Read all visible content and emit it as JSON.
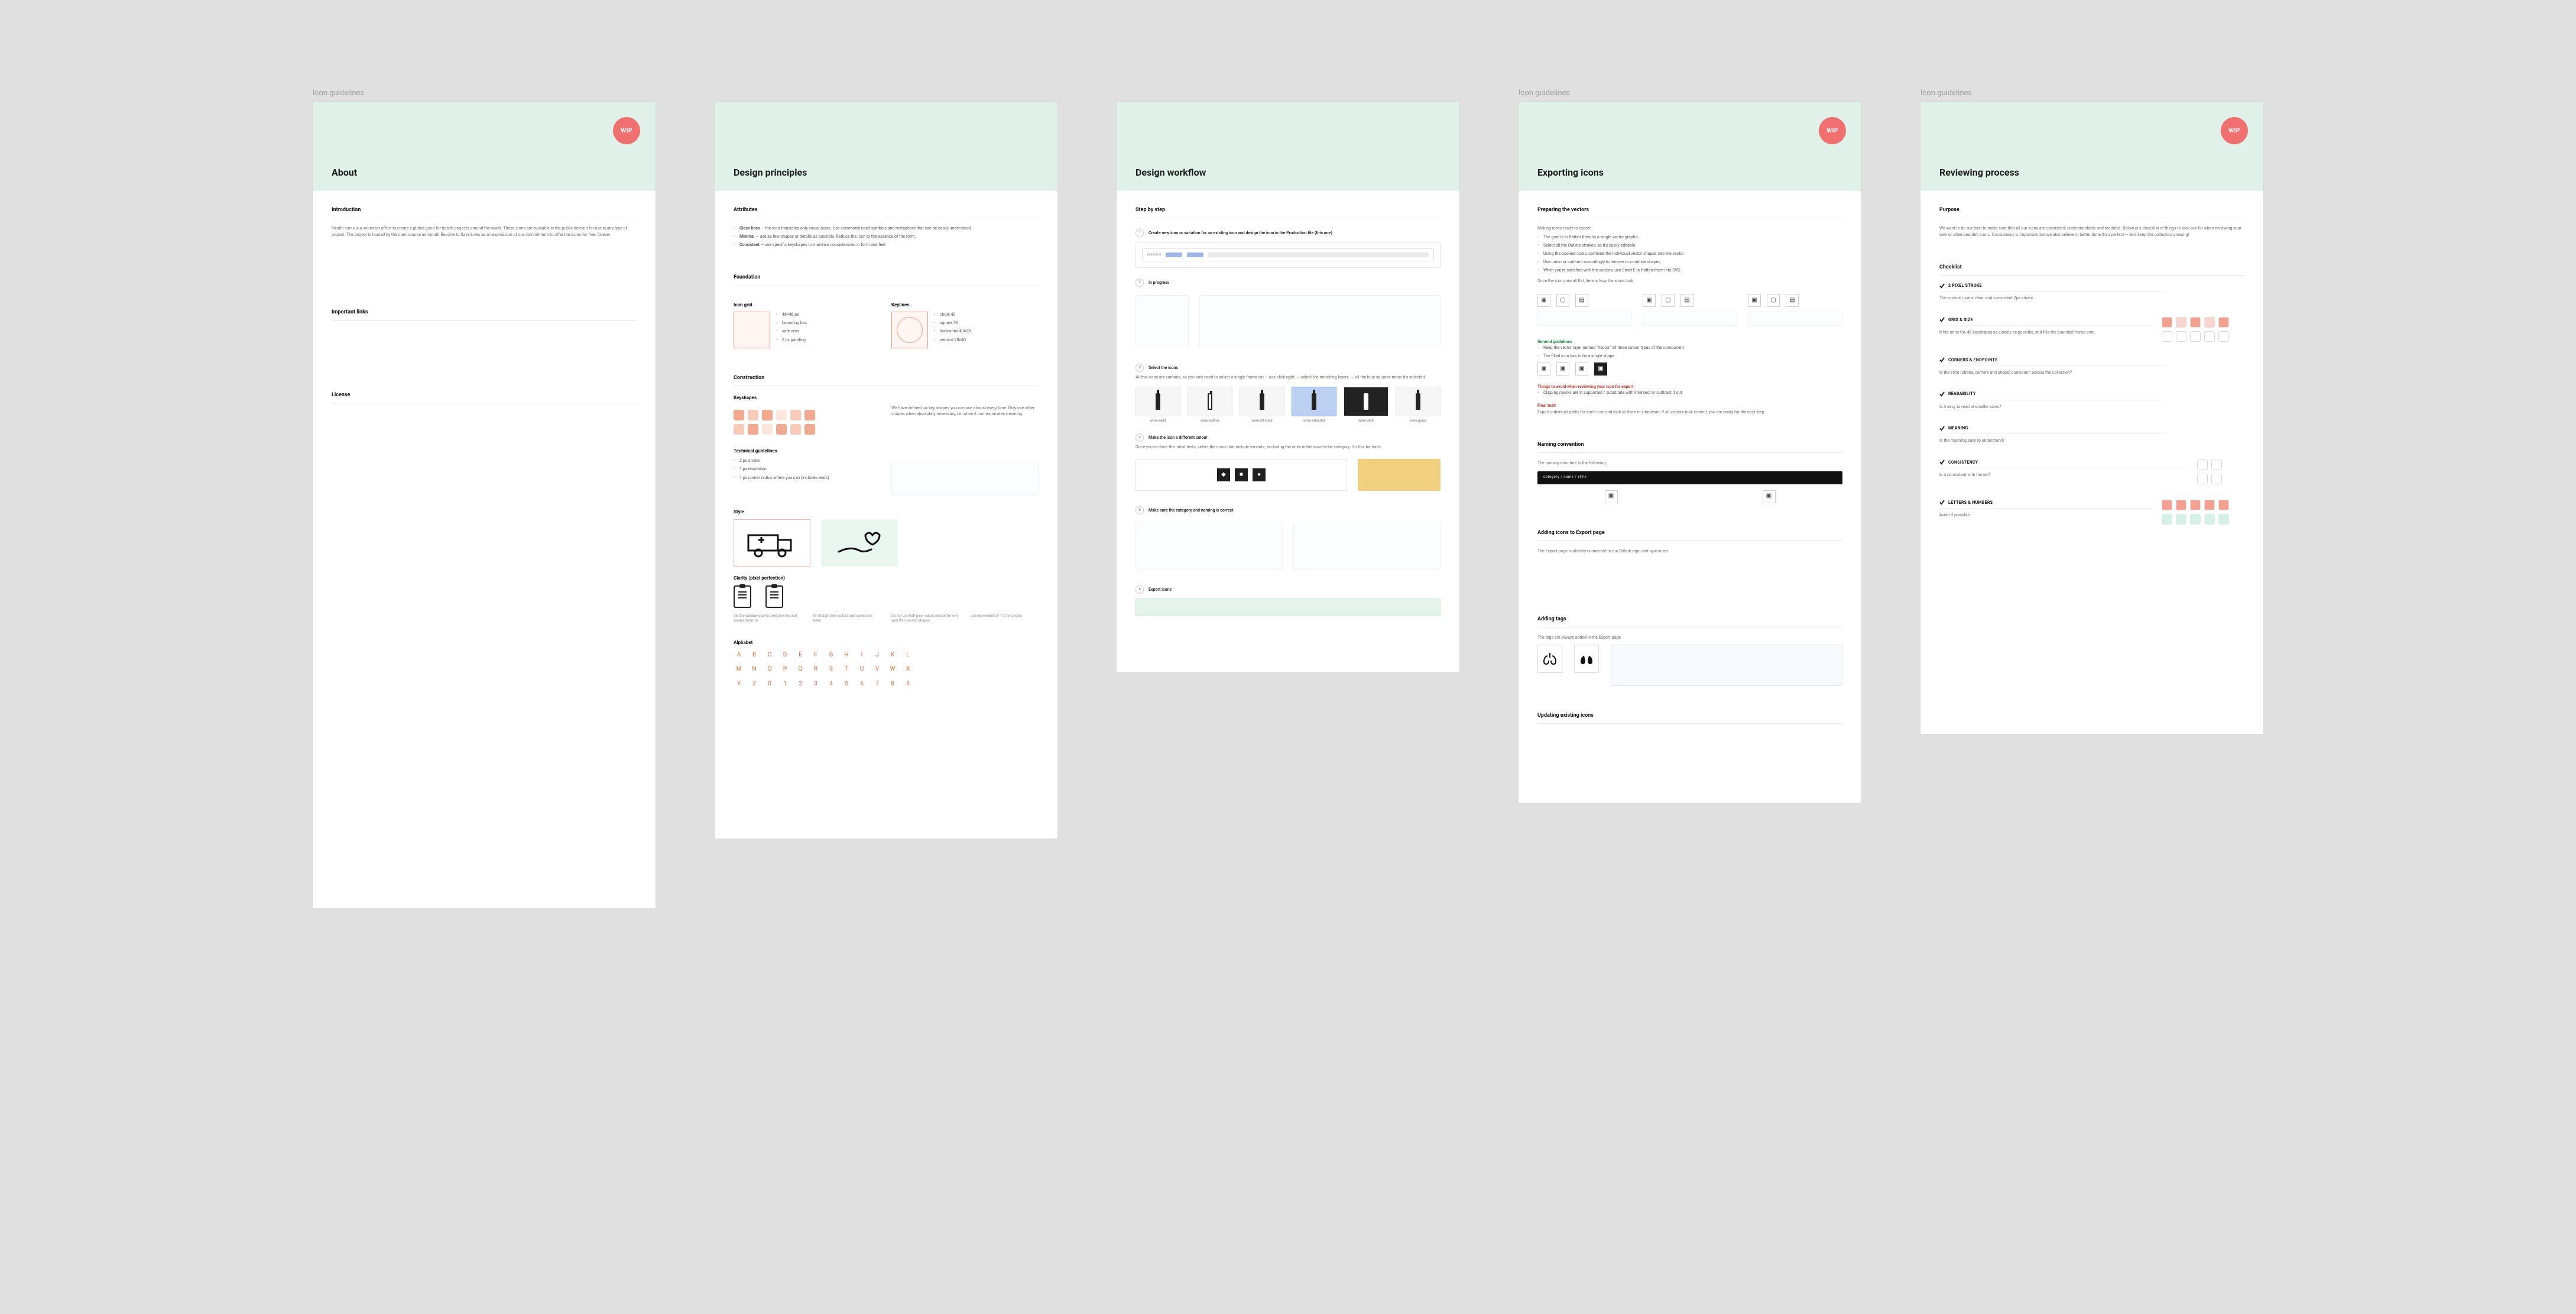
{
  "frame_label": "Icon guidelines",
  "wip": "WIP",
  "about": {
    "title": "About",
    "sections": {
      "intro": {
        "heading": "Introduction",
        "body": "Health icons is a volunteer effort to create a global good for health projects around the world. These icons are available in the public domain for use in any type of project. The project is hosted by the open source non-profit Resolve to Save Lives as an expression of our commitment to offer the icons for free, forever."
      },
      "links": {
        "heading": "Important links"
      },
      "license": {
        "heading": "License"
      }
    }
  },
  "principles": {
    "title": "Design principles",
    "sections": {
      "attributes": {
        "heading": "Attributes",
        "items": [
          {
            "term": "Clean lines",
            "desc": "the icon translates only visual noise. Use commonly used symbols and metaphors that can be easily understood."
          },
          {
            "term": "Minimal",
            "desc": "use as few shapes or details as possible. Reduce the icon to the essence of the form."
          },
          {
            "term": "Consistent",
            "desc": "use specific keyshapes to maintain consistencies in form and feel."
          }
        ]
      },
      "foundation": {
        "heading": "Foundation",
        "icon_grid_label": "Icon grid",
        "keylines_label": "Keylines",
        "icon_grid_notes": [
          "48×48 px",
          "bounding box",
          "safe area",
          "2 px padding"
        ],
        "keylines_notes": [
          "circle 40",
          "square 36",
          "horizontal 40×28",
          "vertical 28×40"
        ]
      },
      "construction": {
        "heading": "Construction",
        "keyshapes_label": "Keyshapes",
        "keyshapes_desc": "We have defined six key shapes you can use almost every time. Only use other shapes when absolutely necessary, i.e. when it communicates meaning.",
        "technical_label": "Technical guidelines",
        "tech_bullets": [
          "2 px stroke",
          "1 px resolution",
          "1 px corner radius where you can (includes ends)"
        ],
        "style_label": "Style",
        "clarity_label": "Clarity (pixel perfection)",
        "clarity_cols": [
          "Set the window size to pixel preview and always zoom in",
          "All straight line vectors and curves are clean",
          "Do not use half pixel values except for very specific rounded shapes",
          "Use increments of 1/2 for angles"
        ],
        "alphabet_label": "Alphabet"
      }
    }
  },
  "workflow": {
    "title": "Design workflow",
    "sections": {
      "steps": {
        "heading": "Step by step",
        "step1": "Create new icon or variation for an existing icon and design the icon in the Production file (this one)",
        "step2": "In progress",
        "step3": "Select the icons",
        "step3_desc": "All the icons are variants, so you only need to select a single frame set — use click right → select the matching layers → all the blue squares mean it's selected.",
        "step4": "Make the icon a different colour",
        "step4_desc": "Once you've done the initial tests, select the icons that include variants, excluding the ones in the soon-to-be category. Do this for each.",
        "step5": "Make sure the category and naming is correct",
        "step6": "Export icons"
      },
      "tiles": [
        {
          "cap": "wine-solid",
          "sel": false
        },
        {
          "cap": "wine-outline",
          "sel": false
        },
        {
          "cap": "wine-alt-solid",
          "sel": false
        },
        {
          "cap": "wine-selected",
          "sel": true
        },
        {
          "cap": "wine-dark",
          "sel": false
        },
        {
          "cap": "wine-glass",
          "sel": false
        }
      ]
    }
  },
  "exporting": {
    "title": "Exporting icons",
    "sections": {
      "prep": {
        "heading": "Preparing the vectors",
        "intro": "Making icons ready to export:",
        "bullets": [
          "The goal is to flatten them to a single vector graphic",
          "Select all the Outline strokes, so it's easily editable",
          "Using the boolean tools, combine the individual vector shapes into the vector",
          "Use union or subtract accordingly to remove or combine shapes",
          "When you're satisfied with the vectors, use Cmd+E to flatten them into SVG"
        ],
        "note": "Once the icons are all flat, here is how the icons look",
        "guidelines_good": "General guidelines",
        "guidelines_good_items": [
          "Keep the vector layer named \"Vector\" all three colour types of the component",
          "The filled icon has to be a single shape"
        ],
        "guidelines_bad": "Things to avoid when reviewing your icon for export",
        "guidelines_bad_items": [
          "Clipping masks aren't supported / substitute with Intersect or subtract it out"
        ],
        "final": "Final test!",
        "final_desc": "Export individual paths for each icon and look at them in a browser. If all vectors look correct, you are ready for the next step."
      },
      "naming": {
        "heading": "Naming convention",
        "desc": "The naming structure is the following:"
      },
      "addexport": {
        "heading": "Adding icons to Export page",
        "desc": "The Export page is already connected to our Github repo and syncacles."
      },
      "tags": {
        "heading": "Adding tags",
        "desc": "The tags are always added in the Export page."
      },
      "updating": {
        "heading": "Updating existing icons"
      }
    }
  },
  "reviewing": {
    "title": "Reviewing process",
    "sections": {
      "purpose": {
        "heading": "Purpose",
        "body": "We want to do our best to make sure that all our icons are consistent, understandable and readable. Below is a checklist of things to look out for when reviewing your own or other people's icons. Consistency is important, but we also believe in better done than perfect — let's keep the collection growing!"
      },
      "checklist": {
        "heading": "Checklist",
        "items": [
          {
            "title": "2 PIXEL STROKE",
            "desc": "The icons all use a clean and consistent 2px stroke."
          },
          {
            "title": "GRID & SIZE",
            "desc": "It fits on to the 48 keyshapes as closely as possible, and fills the bounded frame area."
          },
          {
            "title": "CORNERS & ENDPOINTS",
            "desc": "Is the style (stroke, corners and shape) consistent across the collection?"
          },
          {
            "title": "READABILITY",
            "desc": "Is it easy to read at smaller sizes?"
          },
          {
            "title": "MEANING",
            "desc": "Is the meaning easy to understand?"
          },
          {
            "title": "CONSISTENCY",
            "desc": "Is it consistent with the set?"
          },
          {
            "title": "LETTERS & NUMBERS",
            "desc": "Avoid if possible."
          }
        ]
      }
    }
  }
}
